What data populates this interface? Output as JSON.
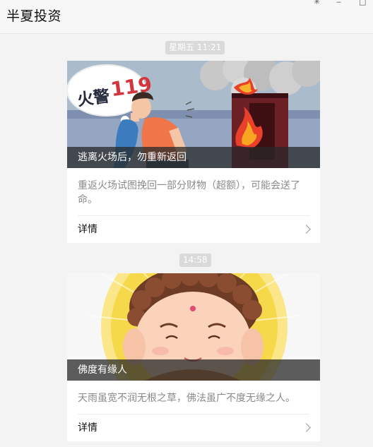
{
  "window": {
    "title": "半夏投资",
    "controls": [
      "pin-icon",
      "minimize-icon",
      "maximize-icon"
    ]
  },
  "messages": [
    {
      "time": "星期五 11:21",
      "caption": "逃离火场后，勿重新返回",
      "description": "重返火场试图挽回一部分财物（超额），可能会送了命。",
      "more_label": "详情",
      "image": {
        "badge_text": "火警",
        "badge_number": "119",
        "scene": "fire-escape-illustration"
      }
    },
    {
      "time": "14:58",
      "caption": "佛度有缘人",
      "description": "天雨虽宽不润无根之草，佛法虽广不度无缘之人。",
      "more_label": "详情",
      "image": {
        "scene": "buddha-illustration"
      }
    }
  ],
  "colors": {
    "background": "#f3f3f3",
    "time_pill": "#dadada",
    "badge_red": "#d4343c",
    "halo_yellow": "#f6d94a"
  }
}
